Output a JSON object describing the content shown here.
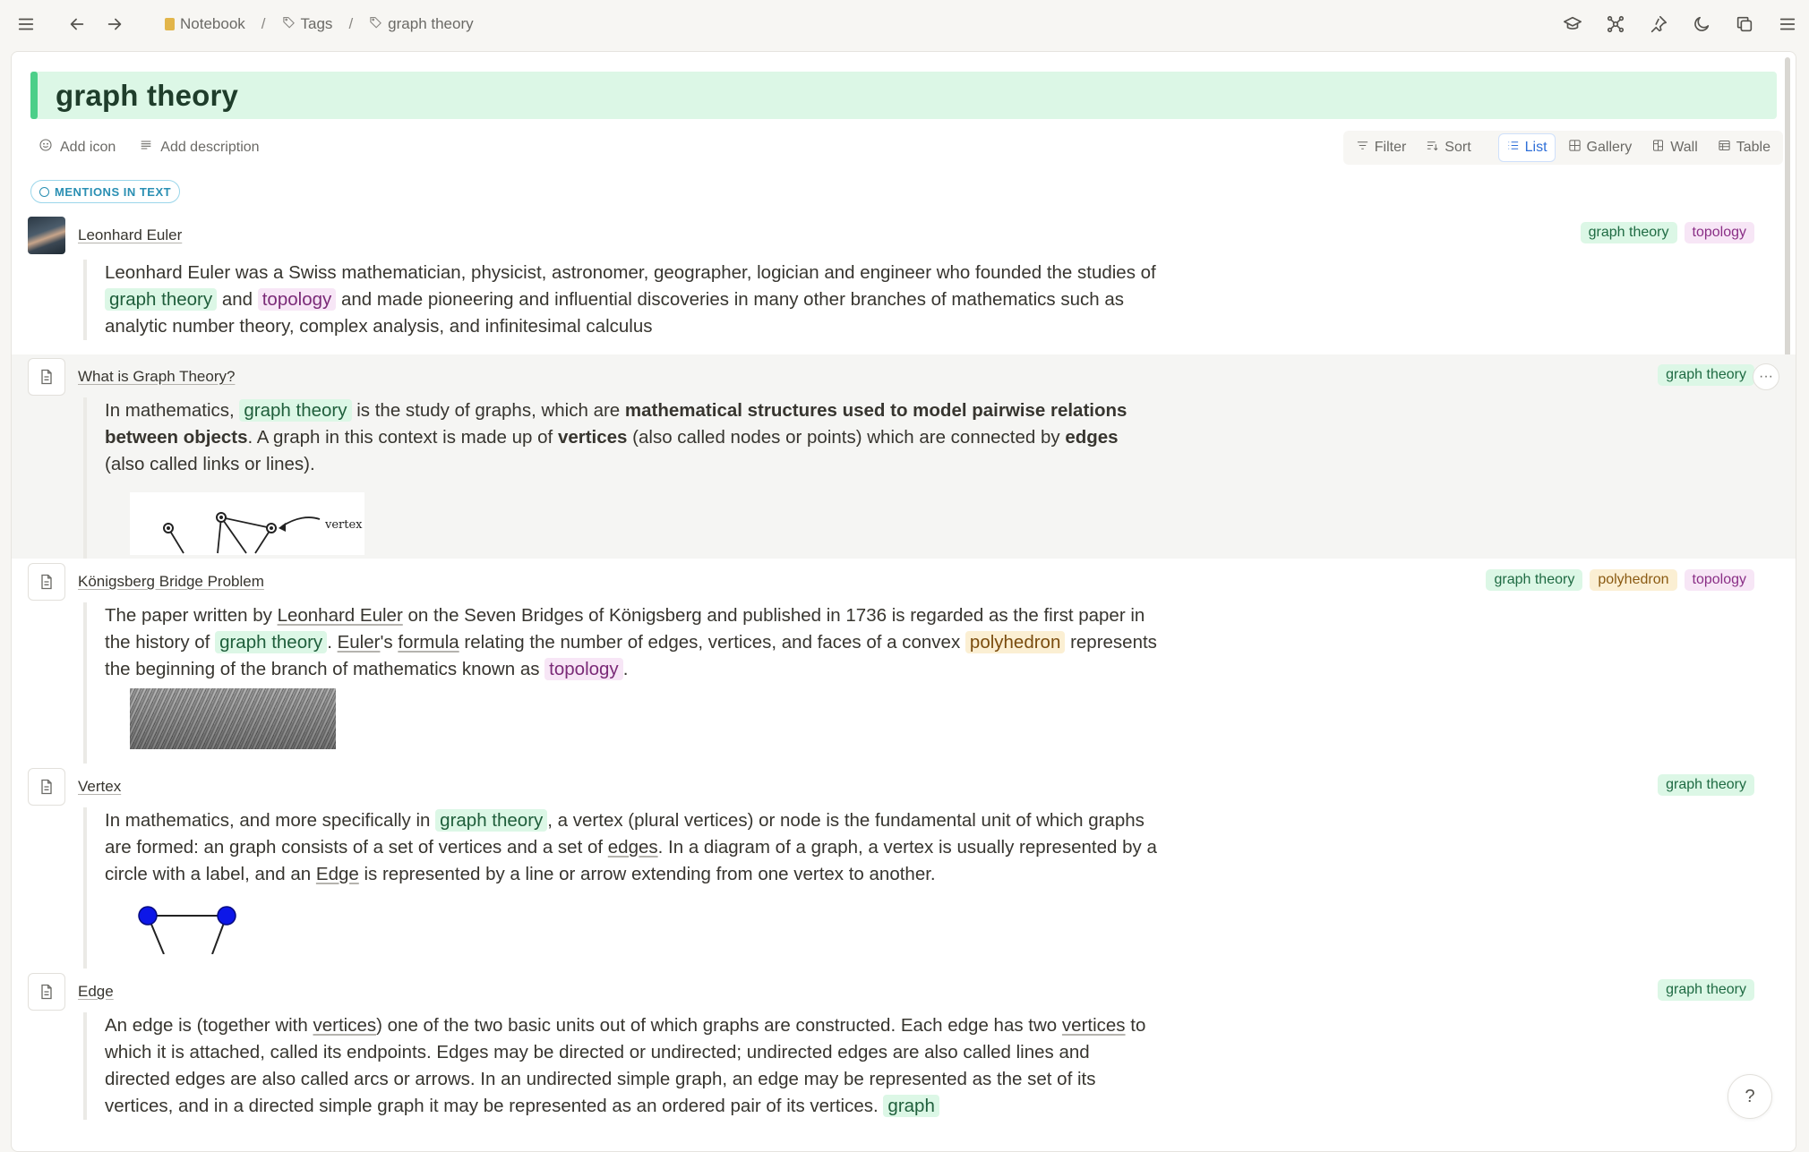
{
  "breadcrumb": {
    "items": [
      {
        "label": "Notebook",
        "icon": "notebook-icon"
      },
      {
        "label": "Tags",
        "icon": "tag-icon"
      },
      {
        "label": "graph theory",
        "icon": "tag-icon"
      }
    ],
    "separator": "/"
  },
  "page": {
    "title": "graph theory",
    "add_icon": "Add icon",
    "add_description": "Add description",
    "mentions_label": "MENTIONS IN TEXT"
  },
  "toolbar": {
    "filter": "Filter",
    "sort": "Sort",
    "views": [
      "List",
      "Gallery",
      "Wall",
      "Table"
    ],
    "active_view": "List"
  },
  "entries": [
    {
      "title": "Leonhard Euler",
      "tags": [
        "graph theory",
        "topology"
      ]
    },
    {
      "title": "What is Graph Theory?",
      "tags": [
        "graph theory"
      ],
      "more": "···",
      "figure_label": "vertex"
    },
    {
      "title": "Königsberg Bridge Problem",
      "tags": [
        "graph theory",
        "polyhedron",
        "topology"
      ]
    },
    {
      "title": "Vertex",
      "tags": [
        "graph theory"
      ]
    },
    {
      "title": "Edge",
      "tags": [
        "graph theory"
      ]
    }
  ],
  "text": {
    "e1_a": "Leonhard Euler was a Swiss mathematician, physicist, astronomer, geographer, logician and engineer who founded the studies of",
    "e1_chip1": "graph theory",
    "e1_b": "and",
    "e1_chip2": "topology",
    "e1_c": "and made pioneering and influential discoveries in many other branches of mathematics such as analytic number theory, complex analysis, and infinitesimal calculus",
    "e2_a": "In mathematics,",
    "e2_chip": "graph theory",
    "e2_b": "is the study of graphs, which are",
    "e2_bold1": "mathematical structures used to model pairwise relations between objects",
    "e2_c": ". A graph in this context is made up of",
    "e2_bold2": "vertices",
    "e2_d": "(also called nodes or points) which are connected by",
    "e2_bold3": "edges",
    "e2_e": "(also called links or lines).",
    "e3_a": "The paper written by",
    "e3_link1": "Leonhard Euler",
    "e3_b": "on the Seven Bridges of Königsberg and published in 1736 is regarded as the first paper in the history of",
    "e3_chip1": "graph theory",
    "e3_c": ".",
    "e3_link2": "Euler",
    "e3_d": "'s",
    "e3_link3": "formula",
    "e3_e": "relating the number of edges, vertices, and faces of a convex",
    "e3_chip2": "polyhedron",
    "e3_f": "represents the beginning of the branch of mathematics known as",
    "e3_chip3": "topology",
    "e3_g": ".",
    "e4_a": "In mathematics, and more specifically in",
    "e4_chip": "graph theory",
    "e4_b": ", a vertex (plural vertices) or node is the fundamental unit of which graphs are formed: an graph consists of a set of vertices and a set of",
    "e4_link1": "edges",
    "e4_c": ". In a diagram of a graph, a vertex is usually represented by a circle with a label, and an",
    "e4_link2": "Edge",
    "e4_d": "is represented by a line or arrow extending from one vertex to another.",
    "e5_a": "An edge is (together with",
    "e5_link1": "vertices",
    "e5_b": ") one of the two basic units out of which graphs are constructed. Each edge has two",
    "e5_link2": "vertices",
    "e5_c": "to which it is attached, called its endpoints. Edges may be directed or undirected; undirected edges are also called lines and directed edges are also called arcs or arrows. In an undirected simple graph, an edge may be represented as the set of its vertices, and in a directed simple graph it may be represented as an ordered pair of its vertices.",
    "e5_chip": "graph"
  },
  "help": "?",
  "colors": {
    "title_bg": "#dcf7e6",
    "title_accent": "#4ccf89",
    "tag_green": "#dcf7e6",
    "tag_purple": "#f7e6f6",
    "tag_yellow": "#fbefd3",
    "active_view": "#2f6fd8"
  }
}
